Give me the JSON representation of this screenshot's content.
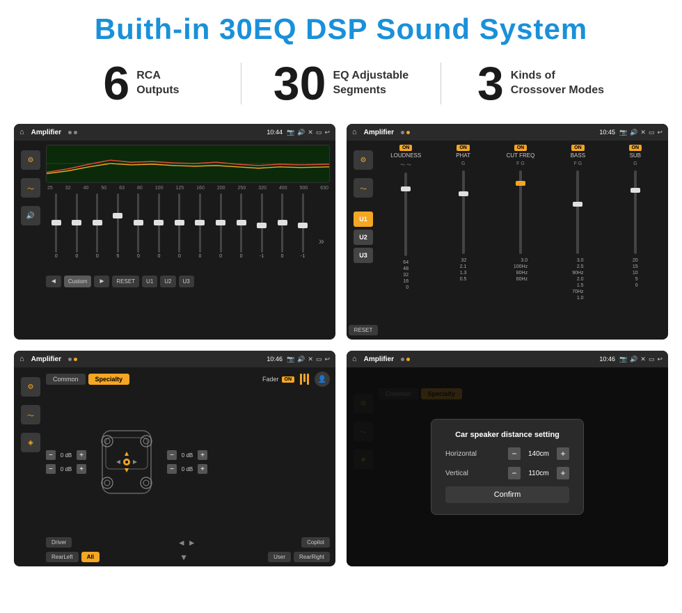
{
  "page": {
    "title": "Buith-in 30EQ DSP Sound System"
  },
  "stats": [
    {
      "number": "6",
      "label_line1": "RCA",
      "label_line2": "Outputs"
    },
    {
      "number": "30",
      "label_line1": "EQ Adjustable",
      "label_line2": "Segments"
    },
    {
      "number": "3",
      "label_line1": "Kinds of",
      "label_line2": "Crossover Modes"
    }
  ],
  "screen1": {
    "app": "Amplifier",
    "time": "10:44",
    "freq_labels": [
      "25",
      "32",
      "40",
      "50",
      "63",
      "80",
      "100",
      "125",
      "160",
      "200",
      "250",
      "320",
      "400",
      "500",
      "630"
    ],
    "slider_values": [
      "0",
      "0",
      "0",
      "5",
      "0",
      "0",
      "0",
      "0",
      "0",
      "0",
      "-1",
      "0",
      "-1"
    ],
    "buttons": [
      "Custom",
      "RESET",
      "U1",
      "U2",
      "U3"
    ]
  },
  "screen2": {
    "app": "Amplifier",
    "time": "10:45",
    "channels": [
      "LOUDNESS",
      "PHAT",
      "CUT FREQ",
      "BASS",
      "SUB"
    ],
    "u_buttons": [
      "U1",
      "U2",
      "U3"
    ]
  },
  "screen3": {
    "app": "Amplifier",
    "time": "10:46",
    "tabs": [
      "Common",
      "Specialty"
    ],
    "fader_label": "Fader",
    "vol_labels": [
      "0 dB",
      "0 dB",
      "0 dB",
      "0 dB"
    ],
    "bottom_buttons": [
      "Driver",
      "",
      "RearLeft",
      "All",
      "",
      "User",
      "RearRight",
      "Copilot"
    ]
  },
  "screen4": {
    "app": "Amplifier",
    "time": "10:46",
    "dialog": {
      "title": "Car speaker distance setting",
      "horizontal_label": "Horizontal",
      "horizontal_value": "140cm",
      "vertical_label": "Vertical",
      "vertical_value": "110cm",
      "confirm_label": "Confirm"
    }
  }
}
